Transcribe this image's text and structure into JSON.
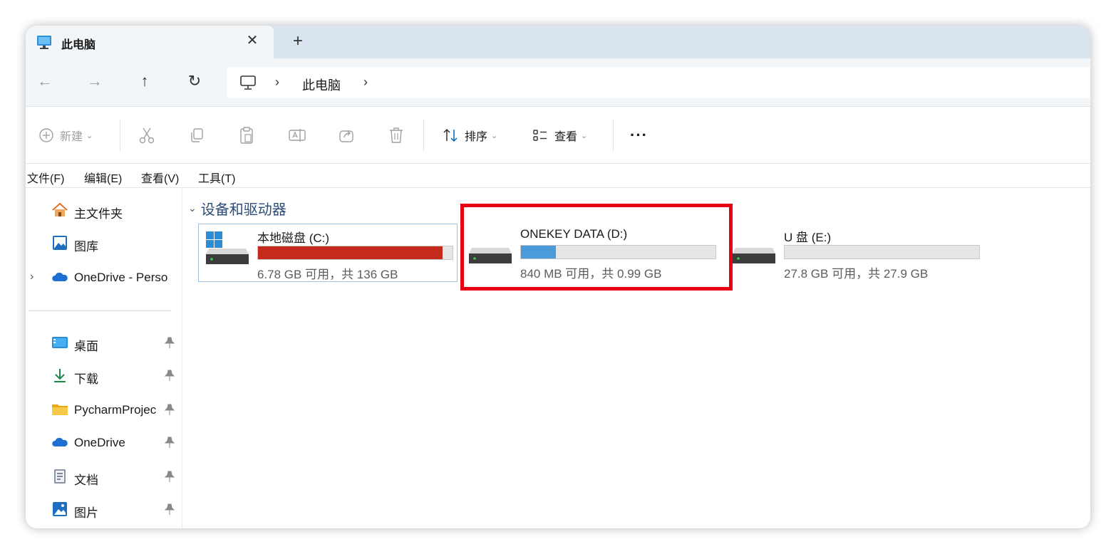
{
  "tab": {
    "title": "此电脑",
    "close_glyph": "✕",
    "new_glyph": "+"
  },
  "nav": {
    "back_glyph": "←",
    "forward_glyph": "→",
    "up_glyph": "↑",
    "refresh_glyph": "↻"
  },
  "address": {
    "separator": "›",
    "crumbs": [
      "此电脑"
    ]
  },
  "commands": {
    "new_label": "新建",
    "sort_label": "排序",
    "view_label": "查看",
    "more_glyph": "···",
    "chevron": "⌄"
  },
  "menu": [
    "文件(F)",
    "编辑(E)",
    "查看(V)",
    "工具(T)"
  ],
  "sidebar": {
    "expander": "›",
    "items": [
      {
        "label": "主文件夹",
        "icon": "home-icon"
      },
      {
        "label": "图库",
        "icon": "gallery-icon"
      },
      {
        "label": "OneDrive - Perso",
        "icon": "onedrive-icon"
      },
      {
        "label": "桌面",
        "icon": "desktop-icon",
        "pinned": true
      },
      {
        "label": "下载",
        "icon": "download-icon",
        "pinned": true
      },
      {
        "label": "PycharmProjec",
        "icon": "folder-icon",
        "pinned": true
      },
      {
        "label": "OneDrive",
        "icon": "onedrive-icon",
        "pinned": true
      },
      {
        "label": "文档",
        "icon": "document-icon",
        "pinned": true
      },
      {
        "label": "图片",
        "icon": "pictures-icon",
        "pinned": true
      }
    ]
  },
  "content": {
    "group_title": "设备和驱动器",
    "group_chevron": "⌄",
    "drives": [
      {
        "name": "本地磁盘 (C:)",
        "free_text": "6.78 GB 可用，共 136 GB",
        "used_fraction": 0.95,
        "bar_color": "#c42b1c"
      },
      {
        "name": "ONEKEY DATA (D:)",
        "free_text": "840 MB 可用，共 0.99 GB",
        "used_fraction": 0.18,
        "bar_color": "#4a9bd9"
      },
      {
        "name": "U 盘 (E:)",
        "free_text": "27.8 GB 可用，共 27.9 GB",
        "used_fraction": 0.0,
        "bar_color": "#4a9bd9"
      }
    ]
  },
  "colors": {
    "accent": "#0067c0",
    "highlight_border": "#e60012",
    "tab_strip": "#d9e4ee"
  }
}
